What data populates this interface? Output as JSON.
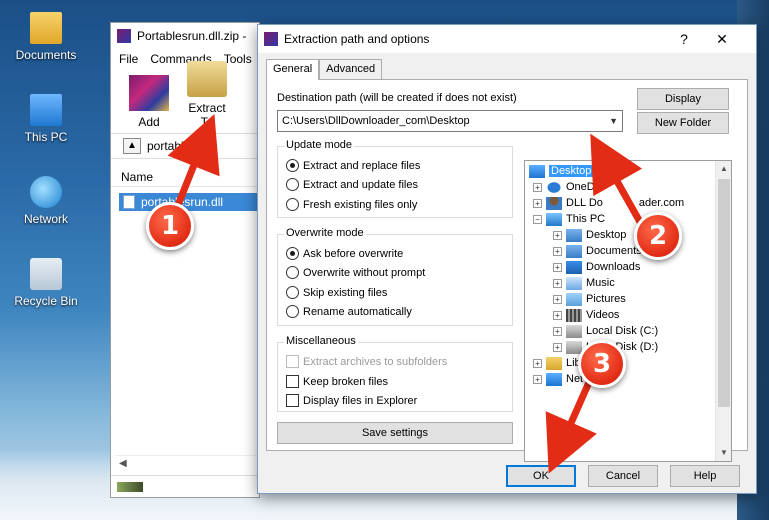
{
  "desktop": {
    "icons": [
      {
        "label": "Documents",
        "icon": "folder-icon"
      },
      {
        "label": "This PC",
        "icon": "computer-icon"
      },
      {
        "label": "Network",
        "icon": "network-icon"
      },
      {
        "label": "Recycle Bin",
        "icon": "recycle-bin-icon"
      }
    ]
  },
  "winrar": {
    "title": "Portablesrun.dll.zip -",
    "menu": [
      "File",
      "Commands",
      "Tools"
    ],
    "toolbar": {
      "add": "Add",
      "extract_to": "Extract To",
      "extra": "T"
    },
    "path": "portablesru",
    "column_name": "Name",
    "file": "portablesrun.dll"
  },
  "dialog": {
    "title": "Extraction path and options",
    "help_glyph": "?",
    "close_glyph": "✕",
    "tabs": [
      "General",
      "Advanced"
    ],
    "destination_label": "Destination path (will be created if does not exist)",
    "destination_value": "C:\\Users\\DllDownloader_com\\Desktop",
    "display_button": "Display",
    "new_folder_button": "New Folder",
    "update_mode": {
      "title": "Update mode",
      "options": [
        "Extract and replace files",
        "Extract and update files",
        "Fresh existing files only"
      ],
      "selected": 0
    },
    "overwrite_mode": {
      "title": "Overwrite mode",
      "options": [
        "Ask before overwrite",
        "Overwrite without prompt",
        "Skip existing files",
        "Rename automatically"
      ],
      "selected": 0
    },
    "misc": {
      "title": "Miscellaneous",
      "options": [
        "Extract archives to subfolders",
        "Keep broken files",
        "Display files in Explorer"
      ]
    },
    "save_settings": "Save settings",
    "tree": [
      "Desktop",
      "OneDrive",
      "DLL Downloader.com",
      "This PC",
      "Desktop",
      "Documents",
      "Downloads",
      "Music",
      "Pictures",
      "Videos",
      "Local Disk (C:)",
      "Local Disk (D:)",
      "Libraries",
      "Network"
    ],
    "tree_visible": {
      "onedrive": "OneDr",
      "dll": "DLL Do",
      "dll_tail": "ader.com",
      "libraries": "Librari",
      "network": "Net"
    },
    "footer": {
      "ok": "OK",
      "cancel": "Cancel",
      "help": "Help"
    }
  },
  "annotations": {
    "step1": "1",
    "step2": "2",
    "step3": "3",
    "color": "#e22c15"
  }
}
